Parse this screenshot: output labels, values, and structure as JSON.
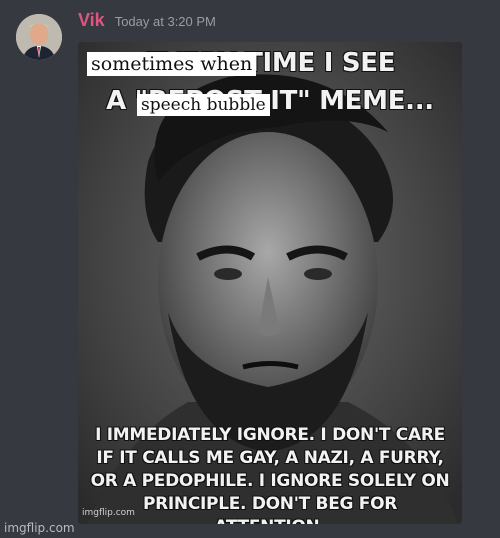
{
  "message": {
    "username": "Vik",
    "timestamp": "Today at 3:20 PM",
    "username_color": "#e0557f",
    "avatar": "user-avatar-portrait"
  },
  "meme": {
    "top_line_1": "EVERY TIME I SEE",
    "top_line_2": "A \"REPOST IT\" MEME...",
    "bottom_caption": "I IMMEDIATELY IGNORE. I DON'T CARE IF IT CALLS ME GAY, A NAZI, A FURRY, OR A PEDOPHILE. I IGNORE SOLELY ON PRINCIPLE. DON'T BEG FOR ATTENTION.",
    "overlay_1": "sometimes when",
    "overlay_2": "speech bubble",
    "inner_watermark": "imgflip.com"
  },
  "footer": {
    "watermark": "imgflip.com"
  }
}
